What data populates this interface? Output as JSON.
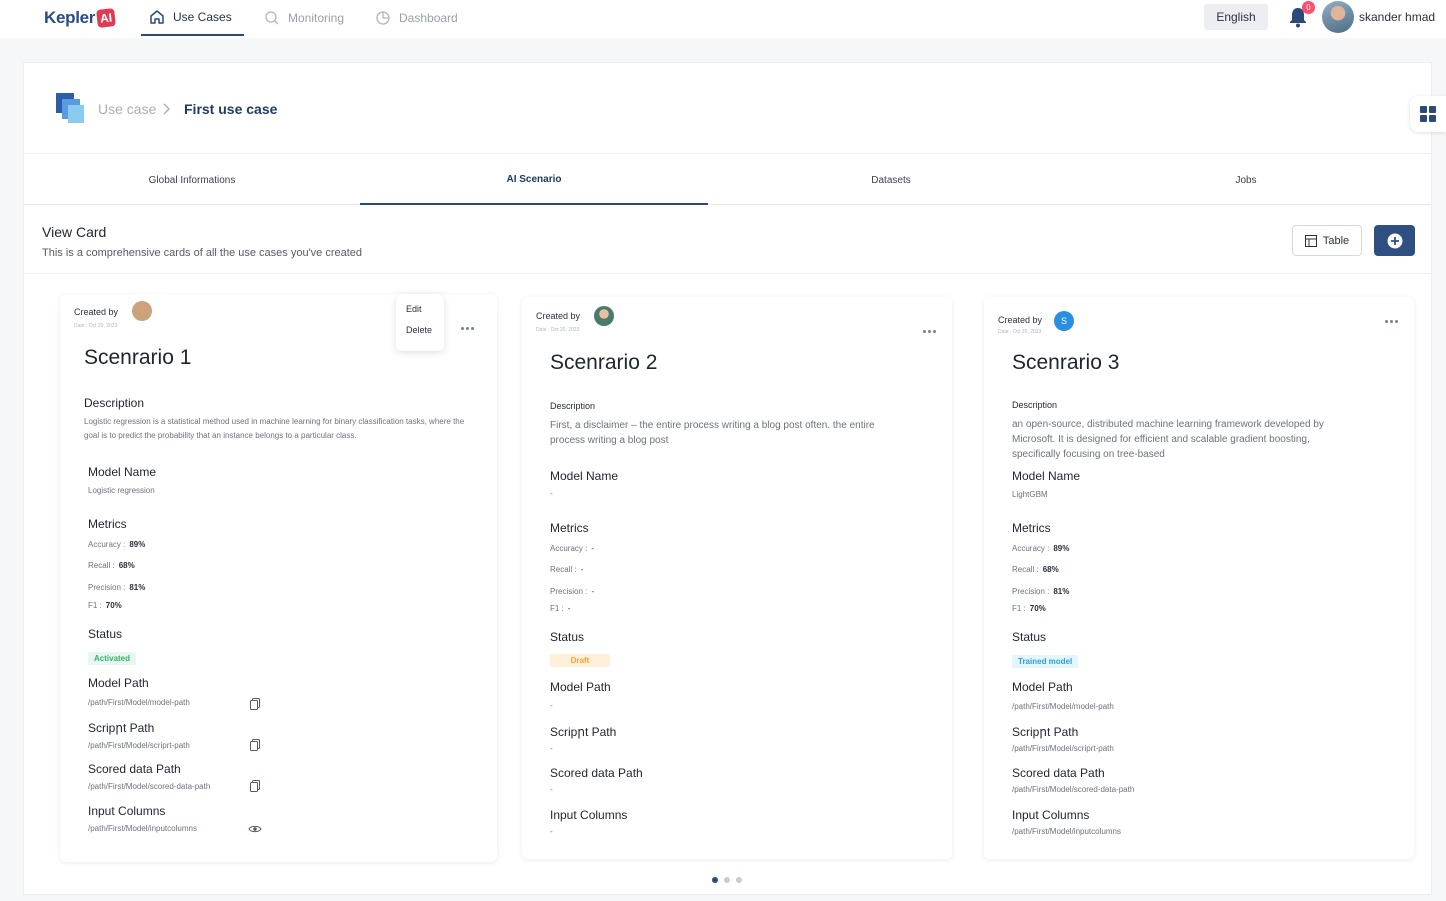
{
  "app": {
    "logo_text": "Kepler",
    "logo_ai": "AI"
  },
  "nav": [
    {
      "label": "Use Cases",
      "icon": "home-icon",
      "active": true
    },
    {
      "label": "Monitoring",
      "icon": "search-icon",
      "active": false
    },
    {
      "label": "Dashboard",
      "icon": "pie-chart-icon",
      "active": false
    }
  ],
  "topbar": {
    "language": "English",
    "notifications_count": "0",
    "user_name": "skander hmad"
  },
  "breadcrumb": {
    "root": "Use case",
    "current": "First use case"
  },
  "tabs": [
    {
      "label": "Global Informations",
      "active": false
    },
    {
      "label": "AI Scenario",
      "active": true
    },
    {
      "label": "Datasets",
      "active": false
    },
    {
      "label": "Jobs",
      "active": false
    }
  ],
  "view": {
    "title": "View Card",
    "subtitle": "This is a comprehensive cards of all the use cases you've created",
    "table_button": "Table"
  },
  "labels": {
    "created_by": "Created by",
    "description": "Description",
    "model_name": "Model Name",
    "metrics": "Metrics",
    "status": "Status",
    "model_path": "Model Path",
    "script_path": "Scripրt Path",
    "scored_path": "Scored data Path",
    "input_columns": "Input Columns",
    "accuracy": "Accuracy :",
    "recall": "Recall :",
    "precision": "Precision :",
    "f1": "F1 :"
  },
  "context_menu": {
    "edit": "Edit",
    "delete": "Delete"
  },
  "cards": [
    {
      "date": "Date : Oct 20, 2023",
      "title": "Scenrario 1",
      "description": "Logistic regression is a statistical method used in machine learning for binary classification tasks, where the goal is to predict the probability that an instance belongs to a particular class.",
      "model_name": "Logistic regression",
      "accuracy": "89%",
      "recall": "68%",
      "precision": "81%",
      "f1": "70%",
      "status": "Activated",
      "model_path": "/path/First/Model/model-path",
      "script_path": "/path/First/Model/scriprt-path",
      "scored_path": "/path/First/Model/scored-data-path",
      "input_columns": "/path/First/Model/inputcolumns"
    },
    {
      "date": "Date : Oct 20, 2023",
      "title": "Scenrario 2",
      "description": "First, a disclaimer – the entire process  writing a blog post often. the entire process  writing a blog post",
      "model_name": "-",
      "accuracy": "-",
      "recall": "-",
      "precision": "-",
      "f1": "-",
      "status": "Draft",
      "model_path": "-",
      "script_path": "-",
      "scored_path": "-",
      "input_columns": "-"
    },
    {
      "date": "Date : Oct 20, 2023",
      "avatar_letter": "S",
      "title": "Scenrario 3",
      "description": "an open-source, distributed machine learning framework developed by Microsoft. It is designed for efficient and scalable gradient boosting, specifically focusing on tree-based",
      "model_name": "LightGBM",
      "accuracy": "89%",
      "recall": "68%",
      "precision": "81%",
      "f1": "70%",
      "status": "Trained model",
      "model_path": "/path/First/Model/model-path",
      "script_path": "/path/First/Model/scriprt-path",
      "scored_path": "/path/First/Model/scored-data-path",
      "input_columns": "/path/First/Model/inputcolumns"
    }
  ],
  "colors": {
    "primary": "#2f4f82",
    "activated": "#32b36b",
    "draft": "#f2a33a",
    "trained": "#2aa3cf"
  }
}
